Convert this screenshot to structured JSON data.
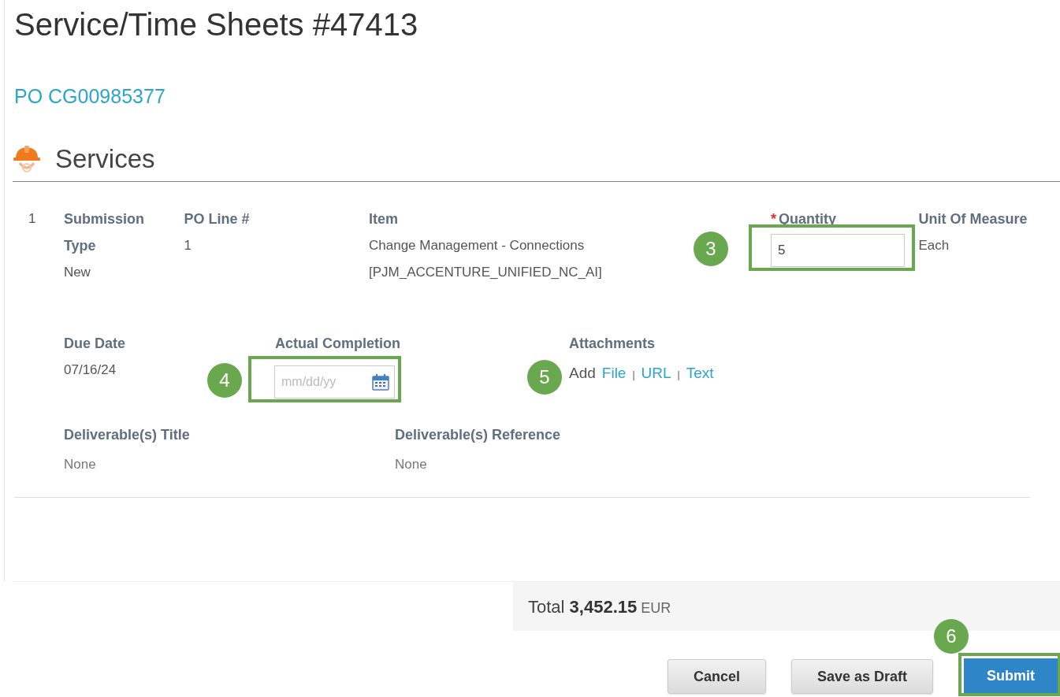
{
  "title": "Service/Time Sheets #47413",
  "po_link": "PO CG00985377",
  "section": {
    "title": "Services"
  },
  "line": {
    "number": "1",
    "submission_type": {
      "label": "Submission Type",
      "value": "New"
    },
    "po_line": {
      "label": "PO Line #",
      "value": "1"
    },
    "item": {
      "label": "Item",
      "value": "Change Management - Connections [PJM_ACCENTURE_UNIFIED_NC_AI]"
    },
    "quantity": {
      "label": "Quantity",
      "required_mark": "*",
      "value": "5",
      "callout": "3"
    },
    "unit": {
      "label": "Unit Of Measure",
      "value": "Each"
    },
    "due_date": {
      "label": "Due Date",
      "value": "07/16/24"
    },
    "actual_completion": {
      "label": "Actual Completion",
      "placeholder": "mm/dd/yy",
      "callout": "4"
    },
    "attachments": {
      "label": "Attachments",
      "prefix": "Add",
      "links": [
        "File",
        "URL",
        "Text"
      ],
      "separator": "|",
      "callout": "5"
    },
    "deliverable_title": {
      "label": "Deliverable(s) Title",
      "value": "None"
    },
    "deliverable_reference": {
      "label": "Deliverable(s) Reference",
      "value": "None"
    }
  },
  "total": {
    "label": "Total",
    "amount": "3,452.15",
    "currency": "EUR"
  },
  "buttons": [
    {
      "label": "Cancel",
      "kind": "secondary"
    },
    {
      "label": "Save as Draft",
      "kind": "secondary"
    },
    {
      "label": "Submit",
      "kind": "primary",
      "callout": "6"
    }
  ]
}
